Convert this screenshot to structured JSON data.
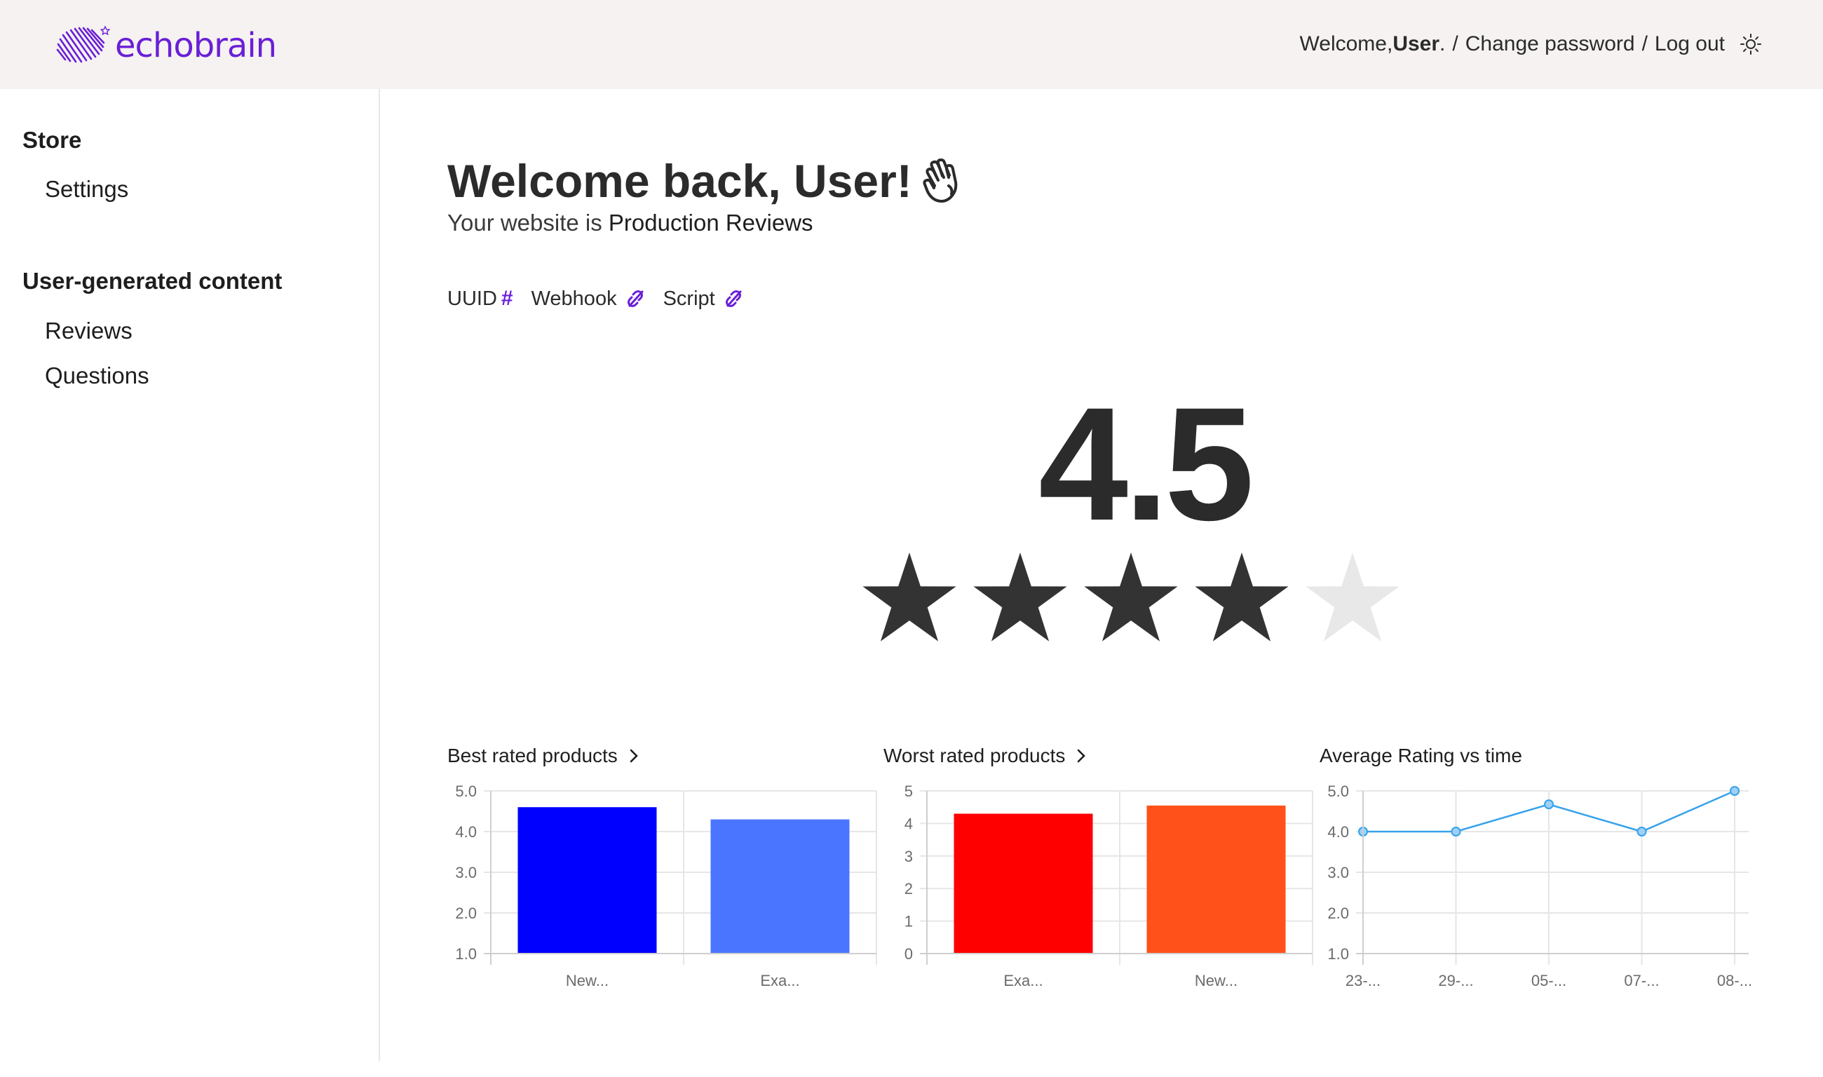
{
  "header": {
    "logo_text": "echobrain",
    "welcome_prefix": "Welcome, ",
    "user_name": "User",
    "welcome_suffix": ".",
    "separator": "/",
    "change_password": "Change password",
    "log_out": "Log out",
    "theme_icon": "sun-icon",
    "brand_color": "#6a1fd6"
  },
  "sidebar": {
    "sections": [
      {
        "title": "Store",
        "items": [
          {
            "label": "Settings"
          }
        ]
      },
      {
        "title": "User-generated content",
        "items": [
          {
            "label": "Reviews"
          },
          {
            "label": "Questions"
          }
        ]
      }
    ]
  },
  "main": {
    "greeting": "Welcome back, User!",
    "greeting_icon": "waving-hand-icon",
    "website_prefix": "Your website is ",
    "website_name": "Production Reviews",
    "meta": [
      {
        "label": "UUID",
        "icon": "hash-icon",
        "symbol": "#"
      },
      {
        "label": "Webhook",
        "icon": "unlink-icon"
      },
      {
        "label": "Script",
        "icon": "unlink-icon"
      }
    ],
    "average_rating": "4.5",
    "stars": {
      "filled": 4,
      "total": 5,
      "filled_color": "#333333",
      "empty_color": "#e8e8e8"
    }
  },
  "charts": {
    "best": {
      "title": "Best rated products"
    },
    "worst": {
      "title": "Worst rated products"
    },
    "trend": {
      "title": "Average Rating vs time"
    }
  },
  "chart_data": [
    {
      "type": "bar",
      "title": "Best rated products",
      "categories": [
        "New...",
        "Exa..."
      ],
      "values": [
        4.6,
        4.3
      ],
      "colors": [
        "#0000ff",
        "#4a76ff"
      ],
      "ylim": [
        1.0,
        5.0
      ],
      "yticks": [
        "5.0",
        "4.0",
        "3.0",
        "2.0",
        "1.0"
      ],
      "grid": true
    },
    {
      "type": "bar",
      "title": "Worst rated products",
      "categories": [
        "Exa...",
        "New..."
      ],
      "values": [
        4.3,
        4.55
      ],
      "colors": [
        "#ff0000",
        "#ff5119"
      ],
      "ylim": [
        0,
        5
      ],
      "yticks": [
        "5",
        "4",
        "3",
        "2",
        "1",
        "0"
      ],
      "grid": true
    },
    {
      "type": "line",
      "title": "Average Rating vs time",
      "x": [
        "23-...",
        "29-...",
        "05-...",
        "07-...",
        "08-..."
      ],
      "values": [
        4.0,
        4.0,
        4.67,
        4.0,
        5.0
      ],
      "color": "#36a2eb",
      "ylim": [
        1.0,
        5.0
      ],
      "yticks": [
        "5.0",
        "4.0",
        "3.0",
        "2.0",
        "1.0"
      ],
      "grid": true
    }
  ]
}
